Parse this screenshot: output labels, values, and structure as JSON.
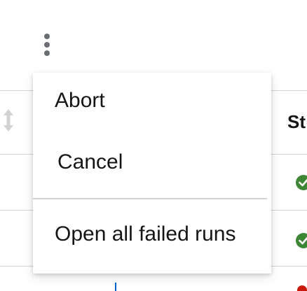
{
  "icons": {
    "kebab": "kebab-vertical-icon",
    "sort": "sort-icon",
    "status_success": "check-circle-icon",
    "status_failed": "exclamation-circle-icon"
  },
  "table": {
    "status_column_header": "St"
  },
  "menu": {
    "items": [
      {
        "label": "Abort"
      },
      {
        "label": "Cancel"
      },
      {
        "label": "Open all failed runs"
      }
    ]
  },
  "colors": {
    "success": "#3e8635",
    "danger": "#c9190b",
    "link": "#0066cc",
    "kebab": "#6a6e73",
    "divider": "#d2d2d2"
  }
}
